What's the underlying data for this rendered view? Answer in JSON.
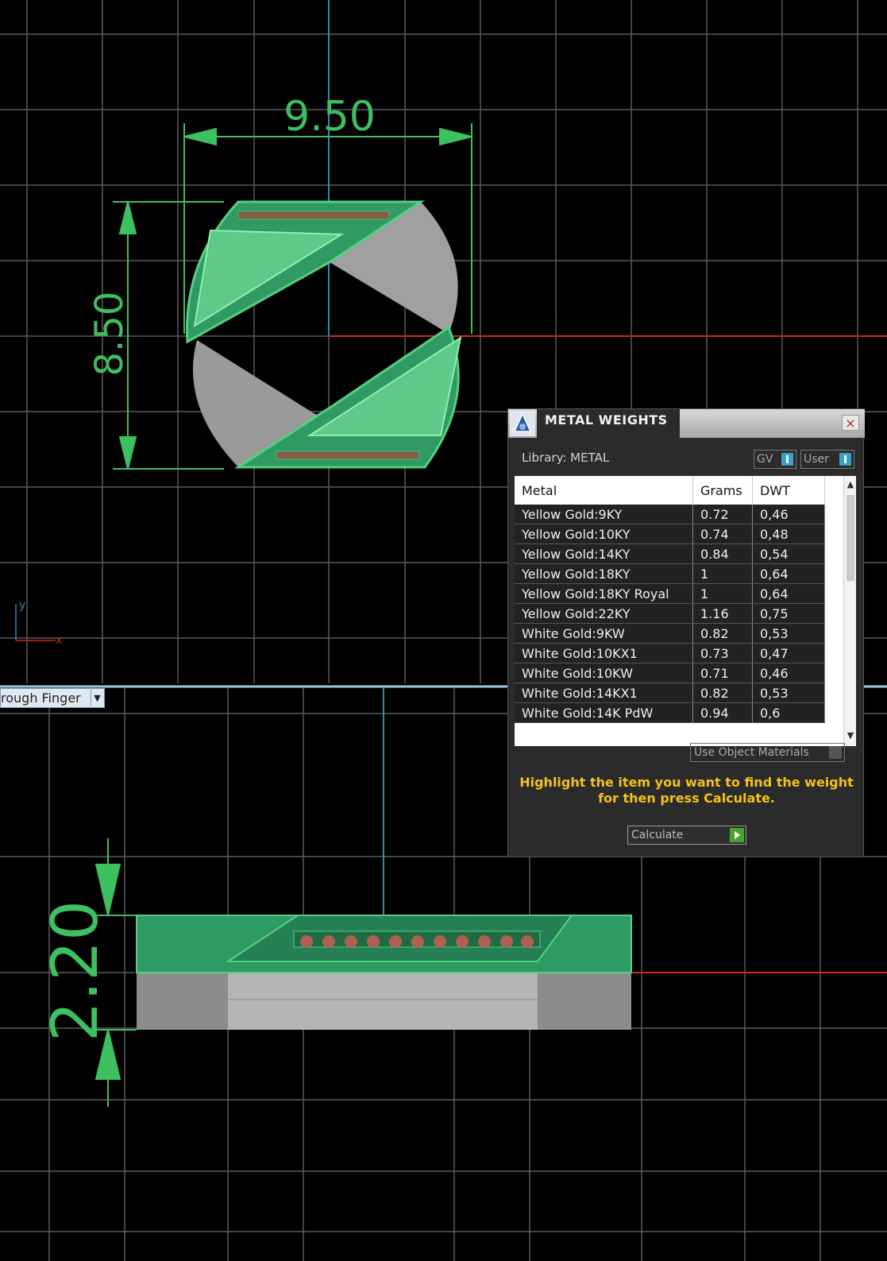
{
  "viewport": {
    "dim_width_top": "9.50",
    "dim_height_top": "8.50",
    "dim_height_side": "2.20",
    "axis_x_label": "x",
    "axis_y_label": "y",
    "view_dropdown_value": "rough Finger"
  },
  "dialog": {
    "title": "METAL WEIGHTS",
    "close_label": "×",
    "library_label": "Library: METAL",
    "gv_label": "GV",
    "user_label": "User",
    "columns": [
      "Metal",
      "Grams",
      "DWT"
    ],
    "rows": [
      {
        "metal": "Yellow Gold:9KY",
        "grams": "0.72",
        "dwt": "0,46"
      },
      {
        "metal": "Yellow Gold:10KY",
        "grams": "0.74",
        "dwt": "0,48"
      },
      {
        "metal": "Yellow Gold:14KY",
        "grams": "0.84",
        "dwt": "0,54"
      },
      {
        "metal": "Yellow Gold:18KY",
        "grams": "1",
        "dwt": "0,64"
      },
      {
        "metal": "Yellow Gold:18KY Royal",
        "grams": "1",
        "dwt": "0,64"
      },
      {
        "metal": "Yellow Gold:22KY",
        "grams": "1.16",
        "dwt": "0,75"
      },
      {
        "metal": "White Gold:9KW",
        "grams": "0.82",
        "dwt": "0,53"
      },
      {
        "metal": "White Gold:10KX1",
        "grams": "0.73",
        "dwt": "0,47"
      },
      {
        "metal": "White Gold:10KW",
        "grams": "0.71",
        "dwt": "0,46"
      },
      {
        "metal": "White Gold:14KX1",
        "grams": "0.82",
        "dwt": "0,53"
      },
      {
        "metal": "White Gold:14K PdW",
        "grams": "0.94",
        "dwt": "0,6"
      }
    ],
    "use_object_materials_label": "Use Object Materials",
    "hint_line1": "Highlight the item you want to find the weight",
    "hint_line2": "for then press Calculate.",
    "calculate_label": "Calculate"
  },
  "colors": {
    "grid": "#5a5a5a",
    "axis_red": "#cc2a1a",
    "axis_blue": "#2a8db0",
    "dimension_green": "#3cc060",
    "hint_yellow": "#f3c21b"
  }
}
